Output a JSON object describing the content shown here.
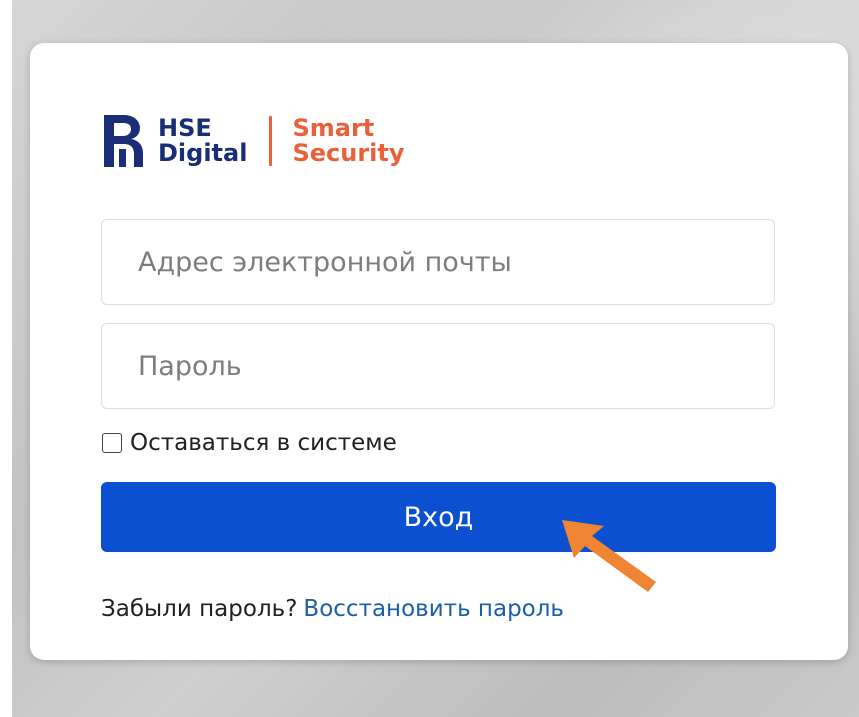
{
  "brand": {
    "primary_line1": "HSE",
    "primary_line2": "Digital",
    "secondary_line1": "Smart",
    "secondary_line2": "Security",
    "color_primary": "#1a2e78",
    "color_accent": "#e8613a"
  },
  "login_form": {
    "email_placeholder": "Адрес электронной почты",
    "email_value": "",
    "password_placeholder": "Пароль",
    "password_value": "",
    "remember_label": "Оставаться в системе",
    "remember_checked": false,
    "submit_label": "Вход",
    "submit_color": "#0a50d0",
    "forgot_text": "Забыли пароль?",
    "restore_link": "Восстановить пароль",
    "link_color": "#1c5fa8"
  },
  "annotation": {
    "icon": "arrow-pointer-icon",
    "color": "#ef8433"
  }
}
